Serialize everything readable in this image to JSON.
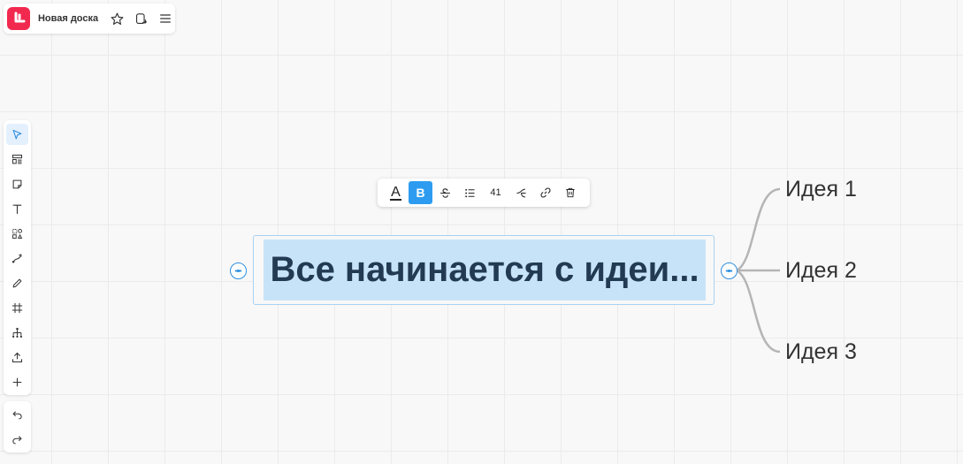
{
  "app": {
    "board_title": "Новая доска",
    "brand_color": "#f2294e",
    "accent_color": "#2d9cf0"
  },
  "topbar": {
    "icons": [
      "app-logo-icon",
      "star-icon",
      "copy-icon",
      "menu-icon"
    ]
  },
  "toolbar": {
    "tools": [
      "select-icon",
      "templates-icon",
      "sticky-note-icon",
      "text-icon",
      "shapes-icon",
      "connector-icon",
      "pen-icon",
      "frame-icon",
      "mindmap-icon",
      "upload-icon",
      "add-icon"
    ],
    "active": "select-icon"
  },
  "history": {
    "tools": [
      "undo-icon",
      "redo-icon"
    ]
  },
  "format_bar": {
    "text_color_label": "A",
    "bold_label": "B",
    "bold_active": true,
    "font_size": "41"
  },
  "mindmap": {
    "root": "Все начинается с идеи...",
    "children": [
      "Идея 1",
      "Идея 2",
      "Идея 3"
    ]
  }
}
